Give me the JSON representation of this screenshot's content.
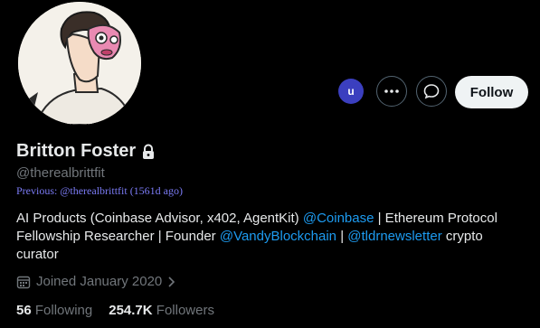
{
  "profile": {
    "display_name": "Britton Foster",
    "handle": "@therealbrittfit",
    "previous_handle": "Previous: @therealbrittfit (1561d ago)",
    "bio": {
      "part1": "AI Products (Coinbase Advisor, x402, AgentKit) ",
      "mention1": "@Coinbase",
      "part2": " | Ethereum Protocol Fellowship Researcher | Founder ",
      "mention2": "@VandyBlockchain",
      "part3": " | ",
      "mention3": "@tldrnewsletter",
      "part4": " crypto curator"
    },
    "joined": "Joined January 2020",
    "following_count": "56",
    "following_label": "Following",
    "followers_count": "254.7K",
    "followers_label": "Followers"
  },
  "actions": {
    "follow_label": "Follow",
    "extension_badge": "u"
  },
  "icons": {
    "lock": "lock-icon",
    "more": "more-dots-icon",
    "message": "message-icon",
    "calendar": "calendar-icon",
    "chevron": "chevron-right-icon"
  },
  "colors": {
    "background": "#000000",
    "accent": "#1d9bf0",
    "muted": "#71767b",
    "extension_badge": "#3b3fbf"
  }
}
